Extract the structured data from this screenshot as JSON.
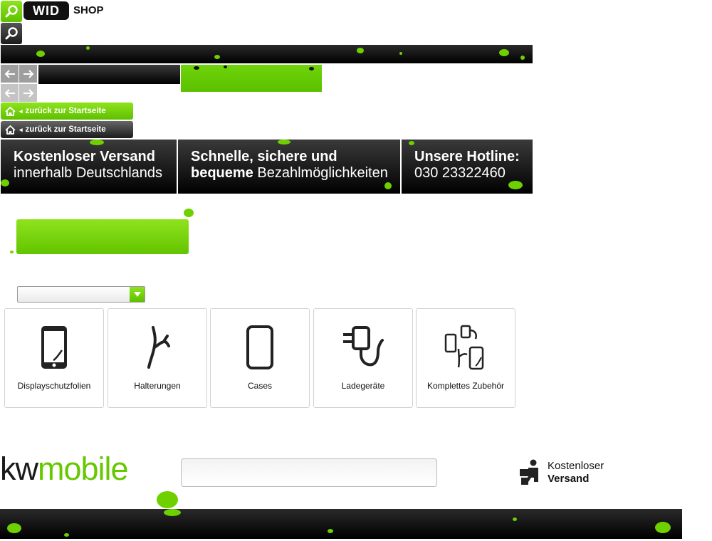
{
  "header": {
    "logo_text": "WID",
    "shop_label": "SHOP",
    "search_icon": "magnifier-icon"
  },
  "nav": {
    "back_label": "zurück zur Startseite",
    "home_icon": "home-icon"
  },
  "usp_banner": {
    "items": [
      {
        "strong": "Kostenloser Versand",
        "normal": "innerhalb Deutschlands"
      },
      {
        "strong": "Schnelle, sichere und",
        "strong2": "bequeme",
        "normal": "Bezahlmöglichkeiten"
      },
      {
        "strong": "Unsere Hotline:",
        "normal": "030 23322460"
      }
    ]
  },
  "categories": [
    {
      "label": "Displayschutzfolien",
      "icon": "phone-screen-icon"
    },
    {
      "label": "Halterungen",
      "icon": "mount-icon"
    },
    {
      "label": "Cases",
      "icon": "case-icon"
    },
    {
      "label": "Ladegeräte",
      "icon": "charger-icon"
    },
    {
      "label": "Komplettes Zubehör",
      "icon": "accessories-icon"
    }
  ],
  "footer": {
    "logo_kw": "kw",
    "logo_mobile": "mobile",
    "shipping_line1": "Kostenloser",
    "shipping_line2": "Versand",
    "shipping_icon": "delivery-person-icon"
  },
  "colors": {
    "brand_green": "#66c800",
    "dark": "#111111"
  }
}
